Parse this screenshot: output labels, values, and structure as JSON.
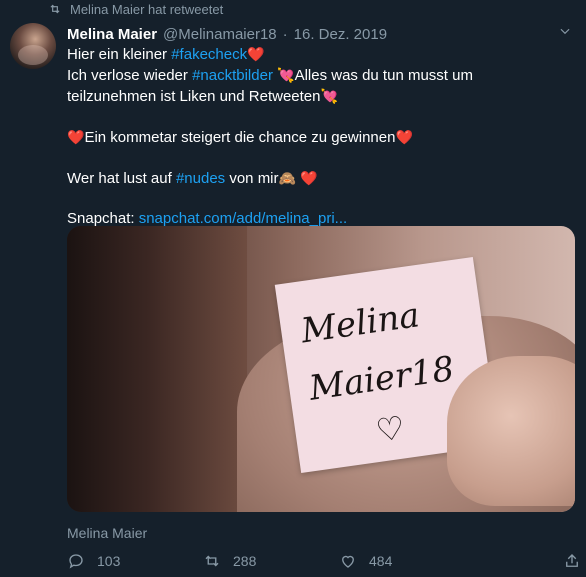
{
  "retweet_notice": "Melina Maier hat retweetet",
  "tweet": {
    "display_name": "Melina Maier",
    "handle": "@Melinamaier18",
    "separator": "·",
    "date": "16. Dez. 2019",
    "line1_text": "Hier ein kleiner ",
    "line1_hashtag": "#fakecheck",
    "line2_text": "Ich verlose wieder ",
    "line2_hashtag": "#nacktbilder",
    "line2_rest": "Alles was du tun musst um",
    "line3_text": "teilzunehmen ist Liken und Retweeten",
    "line4_text": "Ein kommetar steigert die chance zu gewinnen",
    "line5_text": "Wer hat lust auf ",
    "line5_hashtag": "#nudes",
    "line5_rest": " von mir",
    "line6_label": "Snapchat: ",
    "line6_link": "snapchat.com/add/melina_pri..."
  },
  "media": {
    "note_line1": "Melina",
    "note_line2": "Maier18",
    "note_heart": "♡"
  },
  "media_caption": "Melina Maier",
  "actions": {
    "reply_count": "103",
    "retweet_count": "288",
    "like_count": "484"
  },
  "emoji": {
    "red_heart": "❤️",
    "heart_arrow": "💘",
    "see_no_evil": "🙈"
  },
  "colors": {
    "background": "#15202b",
    "secondary_text": "#8899a6",
    "link": "#1da1f2",
    "heart": "#e0245e"
  }
}
